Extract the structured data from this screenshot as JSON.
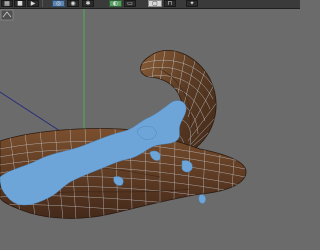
{
  "toolbar": {
    "buttons": [
      {
        "name": "menu-toggle-button",
        "icon": "grid-icon",
        "glyph": "▦"
      },
      {
        "name": "stop-button",
        "icon": "stop-icon",
        "glyph": "■"
      },
      {
        "name": "play-button",
        "icon": "play-icon",
        "glyph": "▶"
      },
      {
        "name": "globe-button",
        "icon": "globe-icon",
        "glyph": "◎"
      },
      {
        "name": "render-button",
        "icon": "render-icon",
        "glyph": "◉"
      },
      {
        "name": "settings-button",
        "icon": "gear-icon",
        "glyph": "✱"
      },
      {
        "name": "view-button",
        "icon": "camera-icon",
        "glyph": "◐"
      },
      {
        "name": "layout-button",
        "icon": "layout-icon",
        "glyph": "▭"
      },
      {
        "name": "frame-button",
        "icon": "frame-icon",
        "glyph": "▢"
      },
      {
        "name": "snap-button",
        "icon": "magnet-icon",
        "glyph": "⊓"
      },
      {
        "name": "lighting-button",
        "icon": "light-icon",
        "glyph": "✦"
      }
    ]
  },
  "viewport": {
    "colors": {
      "background": "#6b6b6b",
      "wood_base": "#5a3b24",
      "wood_highlight": "#8a5c36",
      "wireframe": "#c9cfd6",
      "fluid": "#6ea5d8",
      "grid_axis": "#4fb24f",
      "rotation_line": "#2a2f7a"
    },
    "objects": [
      "wooden-hand-model",
      "fluid-simulation-mesh"
    ]
  }
}
